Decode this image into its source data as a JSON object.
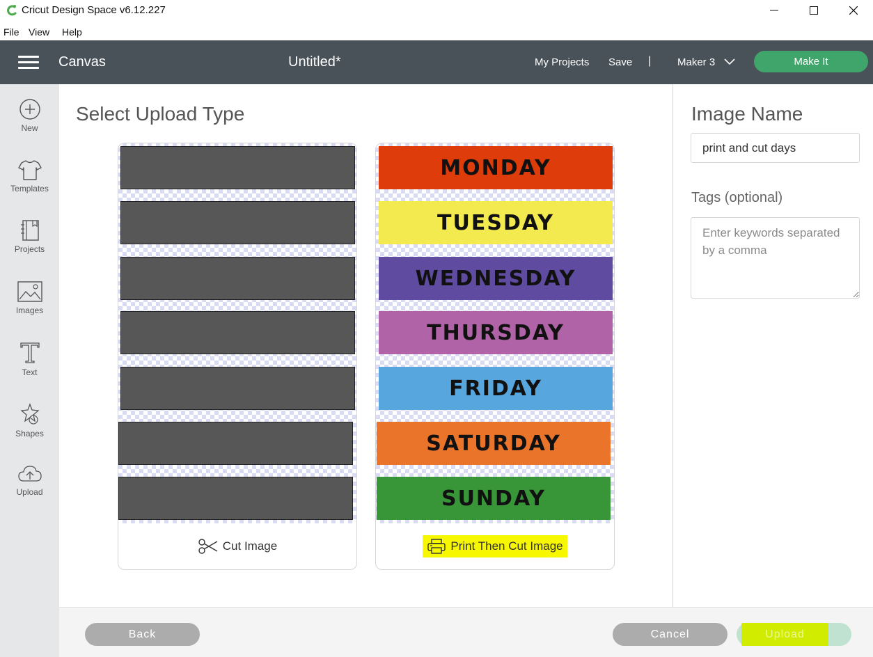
{
  "window": {
    "title": "Cricut Design Space  v6.12.227",
    "controls": [
      "minimize",
      "maximize",
      "close"
    ]
  },
  "menubar": {
    "items": [
      "File",
      "View",
      "Help"
    ]
  },
  "header": {
    "section": "Canvas",
    "document_title": "Untitled*",
    "my_projects": "My Projects",
    "save": "Save",
    "separator": "|",
    "machine": "Maker 3",
    "make_it": "Make It"
  },
  "sidebar": {
    "items": [
      {
        "label": "New",
        "icon": "plus-circle-icon"
      },
      {
        "label": "Templates",
        "icon": "tshirt-icon"
      },
      {
        "label": "Projects",
        "icon": "notebook-icon"
      },
      {
        "label": "Images",
        "icon": "image-icon"
      },
      {
        "label": "Text",
        "icon": "text-t-icon"
      },
      {
        "label": "Shapes",
        "icon": "shapes-icon"
      },
      {
        "label": "Upload",
        "icon": "cloud-upload-icon"
      }
    ]
  },
  "main": {
    "title": "Select Upload Type",
    "cut_card": {
      "label": "Cut Image",
      "icon": "scissors-icon"
    },
    "print_card": {
      "label": "Print Then Cut Image",
      "icon": "printer-icon",
      "days": [
        {
          "text": "MONDAY",
          "color": "#de3c0a"
        },
        {
          "text": "TUESDAY",
          "color": "#f3ea4f"
        },
        {
          "text": "WEDNESDAY",
          "color": "#5f4ba0"
        },
        {
          "text": "THURSDAY",
          "color": "#b163a8"
        },
        {
          "text": "FRIDAY",
          "color": "#58a6de"
        },
        {
          "text": "SATURDAY",
          "color": "#e9742a"
        },
        {
          "text": "SUNDAY",
          "color": "#389638"
        }
      ]
    }
  },
  "right_panel": {
    "image_name_label": "Image Name",
    "image_name_value": "print and cut days",
    "tags_label": "Tags (optional)",
    "tags_placeholder": "Enter keywords separated by a comma"
  },
  "footer": {
    "back": "Back",
    "cancel": "Cancel",
    "upload": "Upload"
  },
  "colors": {
    "header_bg": "#495258",
    "accent_green": "#3fa56b",
    "highlight_yellow": "#f7f700",
    "sidebar_bg": "#e6e7e8"
  }
}
